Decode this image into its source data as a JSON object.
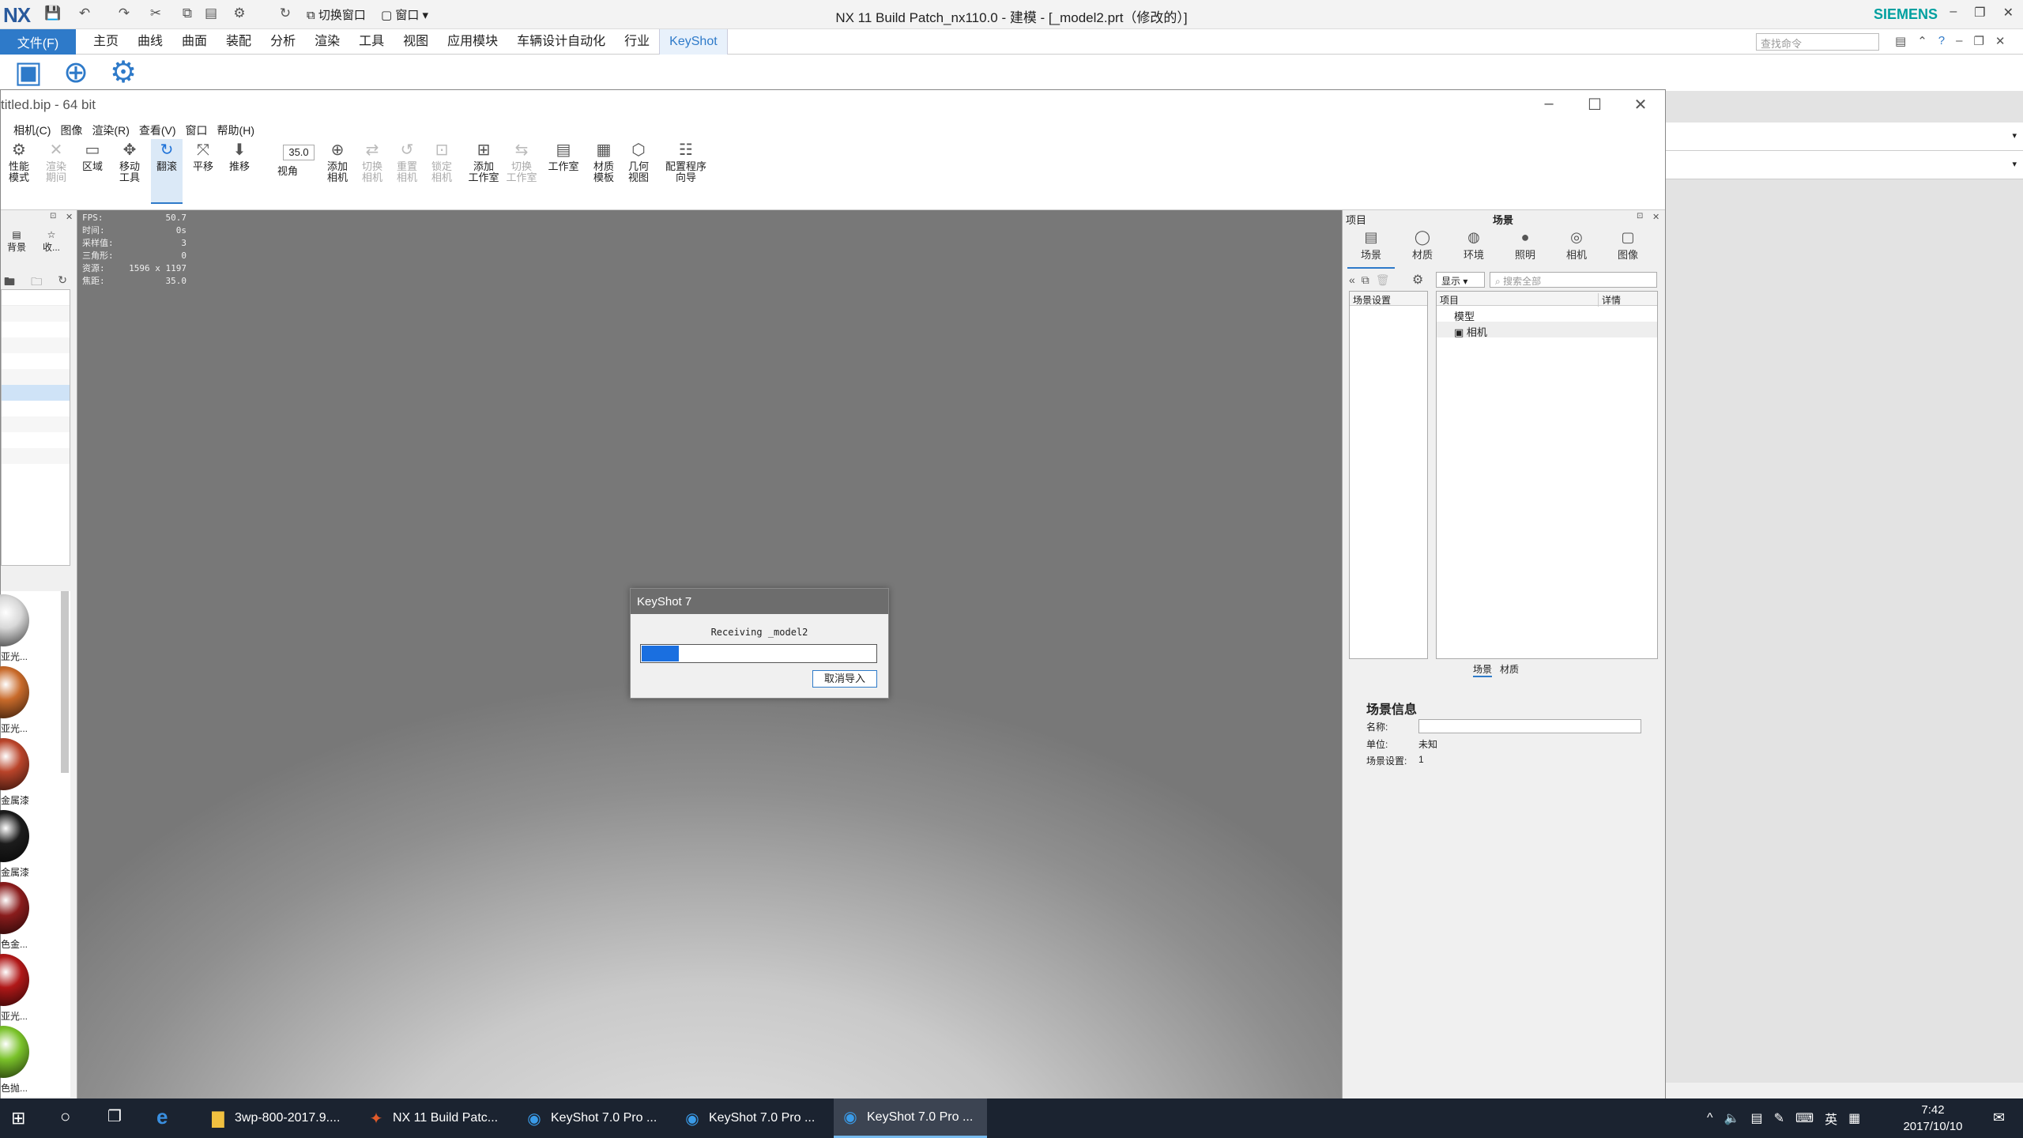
{
  "nx": {
    "logo": "NX",
    "title": "NX 11  Build Patch_nx110.0 - 建模 - [_model2.prt（修改的）]",
    "brand": "SIEMENS",
    "quick_access": {
      "switch_window": "切换窗口",
      "window": "窗口"
    },
    "file_tab": "文件(F)",
    "tabs": [
      "主页",
      "曲线",
      "曲面",
      "装配",
      "分析",
      "渲染",
      "工具",
      "视图",
      "应用模块",
      "车辆设计自动化",
      "行业",
      "KeyShot"
    ],
    "active_tab": "KeyShot",
    "search_placeholder": "查找命令"
  },
  "keyshot": {
    "title": "titled.bip - 64 bit",
    "menu": [
      "相机(C)",
      "图像",
      "渲染(R)",
      "查看(V)",
      "窗口",
      "帮助(H)"
    ],
    "toolbar": [
      {
        "label": "性能\n模式",
        "state": "normal",
        "icon": "performance-icon"
      },
      {
        "label": "渲染\n期间",
        "state": "disabled",
        "icon": "render-pause-icon"
      },
      {
        "label": "区域",
        "state": "normal",
        "icon": "region-icon"
      },
      {
        "label": "移动\n工具",
        "state": "normal",
        "icon": "move-tool-icon"
      },
      {
        "label": "翻滚",
        "state": "active",
        "icon": "tumble-icon"
      },
      {
        "label": "平移",
        "state": "normal",
        "icon": "pan-icon"
      },
      {
        "label": "推移",
        "state": "normal",
        "icon": "dolly-icon"
      },
      {
        "label": "视角",
        "state": "normal",
        "icon": "fov-icon"
      },
      {
        "label": "添加\n相机",
        "state": "normal",
        "icon": "add-camera-icon"
      },
      {
        "label": "切换\n相机",
        "state": "disabled",
        "icon": "switch-camera-icon"
      },
      {
        "label": "重置\n相机",
        "state": "disabled",
        "icon": "reset-camera-icon"
      },
      {
        "label": "锁定\n相机",
        "state": "disabled",
        "icon": "lock-camera-icon"
      },
      {
        "label": "添加\n工作室",
        "state": "normal",
        "icon": "add-studio-icon"
      },
      {
        "label": "切换\n工作室",
        "state": "disabled",
        "icon": "switch-studio-icon"
      },
      {
        "label": "工作室",
        "state": "normal",
        "icon": "studio-icon"
      },
      {
        "label": "材质\n模板",
        "state": "normal",
        "icon": "material-template-icon"
      },
      {
        "label": "几何\n视图",
        "state": "normal",
        "icon": "geometry-view-icon"
      },
      {
        "label": "配置程序\n向导",
        "state": "normal",
        "icon": "configurator-icon"
      }
    ],
    "fov_value": "35.0",
    "library_tabs": [
      "背景",
      "收..."
    ],
    "materials": [
      "亚光...",
      "亚光...",
      "金属漆",
      "金属漆",
      "色金...",
      "亚光...",
      "色抛..."
    ],
    "material_colors": [
      "#d8d8d8",
      "#c86a2a",
      "#b9442a",
      "#1c1c1c",
      "#8a1c1c",
      "#b01818",
      "#7ac22a"
    ],
    "hud": [
      {
        "k": "FPS:",
        "v": "50.7"
      },
      {
        "k": "时间:",
        "v": "0s"
      },
      {
        "k": "采样值:",
        "v": "3"
      },
      {
        "k": "三角形:",
        "v": "0"
      },
      {
        "k": "资源:",
        "v": "1596 x 1197"
      },
      {
        "k": "焦距:",
        "v": "35.0"
      }
    ],
    "project": {
      "panel_label": "项目",
      "panel_title": "场景",
      "tabs": [
        "场景",
        "材质",
        "环境",
        "照明",
        "相机",
        "图像"
      ],
      "display_btn": "显示",
      "search_placeholder": "搜索全部",
      "scene_settings_header": "场景设置",
      "tree_header_item": "项目",
      "tree_header_detail": "详情",
      "tree": [
        "模型",
        "相机"
      ],
      "bottom_tabs": [
        "场景",
        "材质"
      ],
      "info_title": "场景信息",
      "name_label": "名称:",
      "unit_label": "单位:",
      "unit_value": "未知",
      "scene_count_label": "场景设置:",
      "scene_count_value": "1"
    },
    "dialog": {
      "title": "KeyShot 7",
      "message": "Receiving _model2",
      "progress": 0.16,
      "cancel": "取消导入"
    }
  },
  "taskbar": {
    "items": [
      {
        "label": "3wp-800-2017.9....",
        "icon": "folder-icon"
      },
      {
        "label": "NX 11  Build Patc...",
        "icon": "nx-app-icon"
      },
      {
        "label": "KeyShot 7.0 Pro ...",
        "icon": "keyshot-icon"
      },
      {
        "label": "KeyShot 7.0 Pro ...",
        "icon": "keyshot-icon"
      },
      {
        "label": "KeyShot 7.0 Pro ...",
        "icon": "keyshot-icon"
      }
    ],
    "ime": "英",
    "time": "7:42",
    "date": "2017/10/10"
  }
}
